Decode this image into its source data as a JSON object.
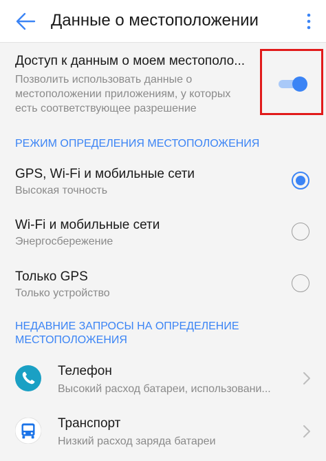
{
  "header": {
    "title": "Данные о местоположении",
    "back_icon": "arrow-left-icon",
    "menu_icon": "more-vertical-icon"
  },
  "location_access": {
    "title": "Доступ к данным о моем местополо...",
    "description_lines": [
      "Позволить использовать данные о",
      "местоположении приложениям, у которых",
      "есть соответствующее разрешение"
    ],
    "enabled": true
  },
  "mode_section": {
    "header": "РЕЖИМ ОПРЕДЕЛЕНИЯ МЕСТОПОЛОЖЕНИЯ",
    "options": [
      {
        "title": "GPS, Wi-Fi и мобильные сети",
        "subtitle": "Высокая точность",
        "selected": true
      },
      {
        "title": "Wi-Fi и мобильные сети",
        "subtitle": "Энергосбережение",
        "selected": false
      },
      {
        "title": "Только GPS",
        "subtitle": "Только устройство",
        "selected": false
      }
    ]
  },
  "recent_section": {
    "header_lines": [
      "НЕДАВНИЕ ЗАПРОСЫ НА ОПРЕДЕЛЕНИЕ",
      "МЕСТОПОЛОЖЕНИЯ"
    ],
    "apps": [
      {
        "name": "Телефон",
        "detail": "Высокий расход батареи, использовани...",
        "icon": "phone-icon"
      },
      {
        "name": "Транспорт",
        "detail": "Низкий расход заряда батареи",
        "icon": "bus-icon"
      }
    ]
  },
  "colors": {
    "accent": "#3b84f5",
    "highlight_box": "#e11a1a",
    "background": "#f4f4f4",
    "app_icon": "#1aa0c4"
  }
}
